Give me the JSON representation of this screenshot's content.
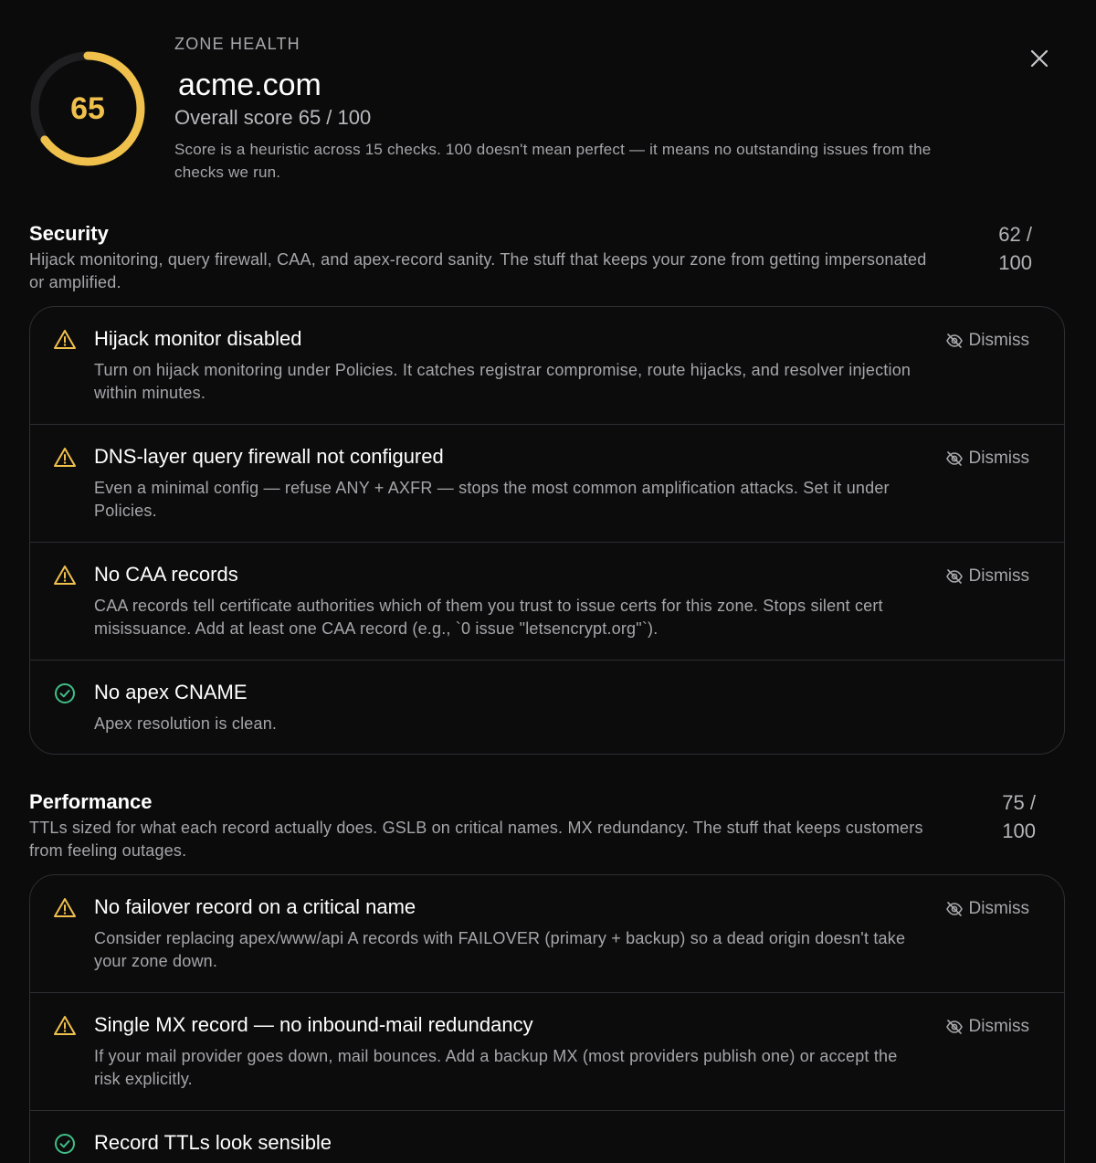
{
  "header": {
    "eyebrow": "ZONE HEALTH",
    "zone_name": "acme.com",
    "score": "65",
    "score_fraction": 0.65,
    "overall_label": "Overall score 65 / 100",
    "note": "Score is a heuristic across 15 checks. 100 doesn't mean perfect — it means no outstanding issues from the checks we run.",
    "close_icon": "close-icon"
  },
  "colors": {
    "accent": "#f0c04c",
    "warning": "#f0c04c",
    "ok": "#3fbf86",
    "background": "#0b0b0c"
  },
  "security": {
    "title": "Security",
    "description": "Hijack monitoring, query firewall, CAA, and apex-record sanity. The stuff that keeps your zone from getting impersonated or amplified.",
    "score_line1": "62 /",
    "score_line2": "100",
    "checks": [
      {
        "status": "warning",
        "icon": "warning-icon",
        "title": "Hijack monitor disabled",
        "description": "Turn on hijack monitoring under Policies. It catches registrar compromise, route hijacks, and resolver injection within minutes.",
        "dismiss_label": "Dismiss"
      },
      {
        "status": "warning",
        "icon": "warning-icon",
        "title": "DNS-layer query firewall not configured",
        "description": "Even a minimal config — refuse ANY + AXFR — stops the most common amplification attacks. Set it under Policies.",
        "dismiss_label": "Dismiss"
      },
      {
        "status": "warning",
        "icon": "warning-icon",
        "title": "No CAA records",
        "description": "CAA records tell certificate authorities which of them you trust to issue certs for this zone. Stops silent cert misissuance. Add at least one CAA record (e.g., `0 issue \"letsencrypt.org\"`).",
        "dismiss_label": "Dismiss"
      },
      {
        "status": "ok",
        "icon": "check-circle-icon",
        "title": "No apex CNAME",
        "description": "Apex resolution is clean."
      }
    ]
  },
  "performance": {
    "title": "Performance",
    "description": "TTLs sized for what each record actually does. GSLB on critical names. MX redundancy. The stuff that keeps customers from feeling outages.",
    "score_line1": "75 /",
    "score_line2": "100",
    "checks": [
      {
        "status": "warning",
        "icon": "warning-icon",
        "title": "No failover record on a critical name",
        "description": "Consider replacing apex/www/api A records with FAILOVER (primary + backup) so a dead origin doesn't take your zone down.",
        "dismiss_label": "Dismiss"
      },
      {
        "status": "warning",
        "icon": "warning-icon",
        "title": "Single MX record — no inbound-mail redundancy",
        "description": "If your mail provider goes down, mail bounces. Add a backup MX (most providers publish one) or accept the risk explicitly.",
        "dismiss_label": "Dismiss"
      },
      {
        "status": "ok",
        "icon": "check-circle-icon",
        "title": "Record TTLs look sensible"
      }
    ]
  }
}
